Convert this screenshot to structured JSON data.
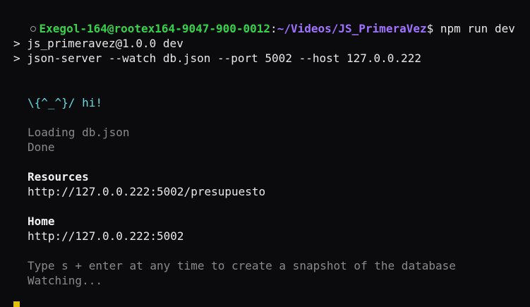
{
  "prompt": {
    "user_host": "Exegol-164@rootex164-9047-900-0012",
    "colon": ":",
    "path": "~/Videos/JS_PrimeraVez",
    "symbol": "$",
    "command": " npm run dev"
  },
  "npm_output": {
    "line1": "> js_primeravez@1.0.0 dev",
    "line2": "> json-server --watch db.json --port 5002 --host 127.0.0.222"
  },
  "server": {
    "greeting": "\\{^_^}/ hi!",
    "loading": "Loading db.json",
    "done": "Done",
    "resources_heading": "Resources",
    "resources_url": "http://127.0.0.222:5002/presupuesto",
    "home_heading": "Home",
    "home_url": "http://127.0.0.222:5002",
    "snapshot_hint": "Type s + enter at any time to create a snapshot of the database",
    "watching": "Watching..."
  },
  "colors": {
    "background": "#0b0b0d",
    "user_host": "#34d34a",
    "path": "#a172ff",
    "greeting": "#62d8e0",
    "muted": "#8a8a8a",
    "cursor": "#e2c200"
  }
}
